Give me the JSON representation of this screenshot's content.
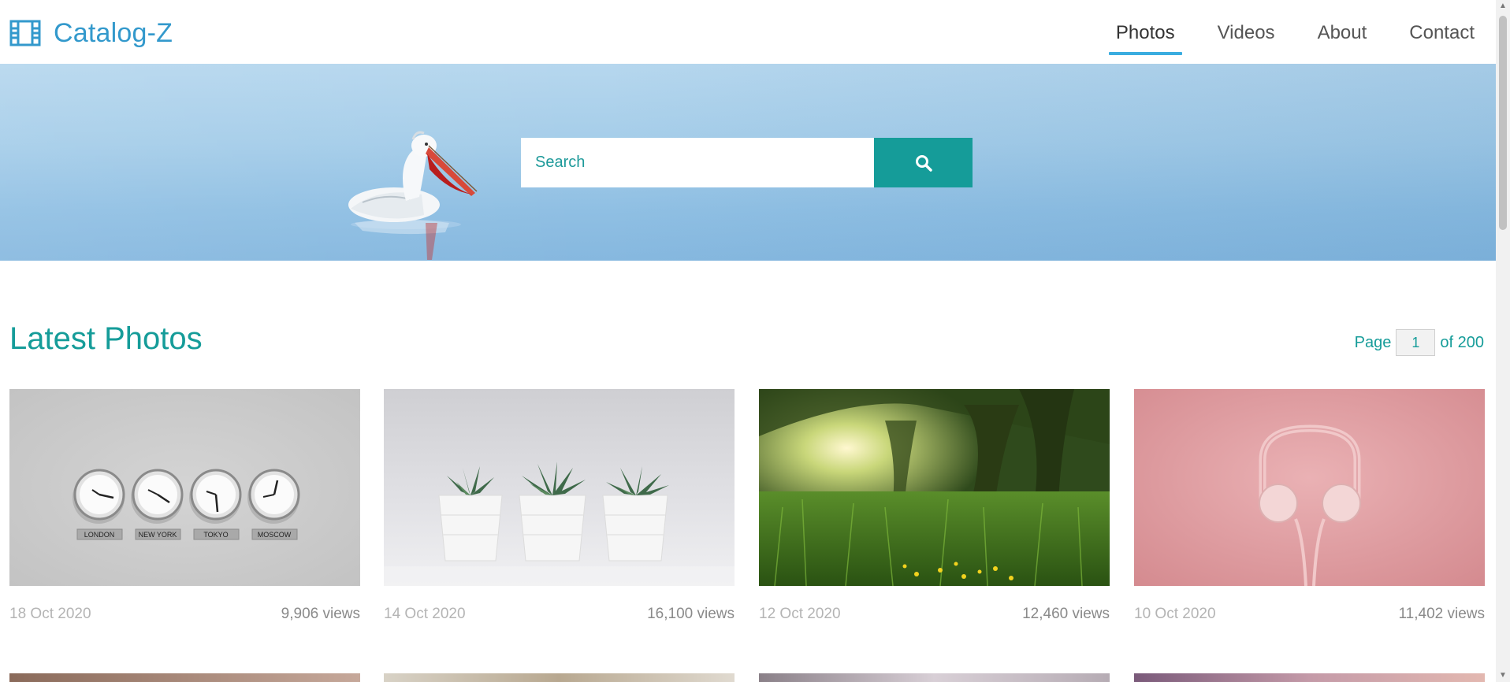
{
  "brand": {
    "name": "Catalog-Z",
    "icon": "film-icon"
  },
  "nav": {
    "items": [
      {
        "label": "Photos",
        "active": true
      },
      {
        "label": "Videos",
        "active": false
      },
      {
        "label": "About",
        "active": false
      },
      {
        "label": "Contact",
        "active": false
      }
    ]
  },
  "search": {
    "placeholder": "Search",
    "value": "",
    "button_icon": "search-icon"
  },
  "section": {
    "title": "Latest Photos"
  },
  "pager": {
    "label": "Page",
    "current": "1",
    "of_label": "of 200"
  },
  "photos": [
    {
      "date": "18 Oct 2020",
      "views": "9,906 views",
      "subject": "world clocks",
      "clock_labels": [
        "LONDON",
        "NEW YORK",
        "TOKYO",
        "MOSCOW"
      ]
    },
    {
      "date": "14 Oct 2020",
      "views": "16,100 views",
      "subject": "potted succulents"
    },
    {
      "date": "12 Oct 2020",
      "views": "12,460 views",
      "subject": "sunlit meadow"
    },
    {
      "date": "10 Oct 2020",
      "views": "11,402 views",
      "subject": "pink headphones"
    }
  ],
  "colors": {
    "accent": "#159c99",
    "brand": "#3399cc",
    "nav_underline": "#3aade0"
  }
}
